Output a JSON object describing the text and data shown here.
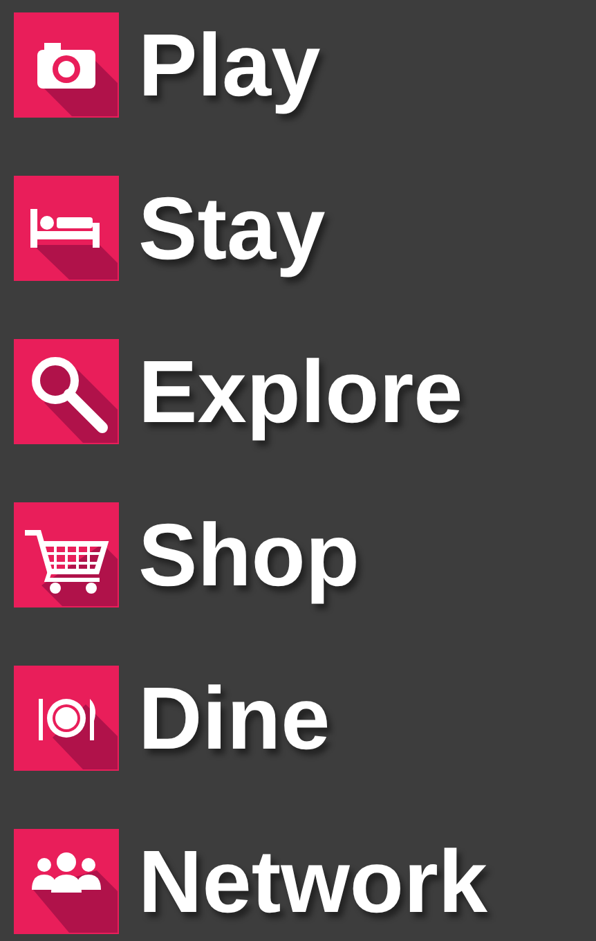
{
  "menu": {
    "items": [
      {
        "label": "Play"
      },
      {
        "label": "Stay"
      },
      {
        "label": "Explore"
      },
      {
        "label": "Shop"
      },
      {
        "label": "Dine"
      },
      {
        "label": "Network"
      }
    ]
  }
}
